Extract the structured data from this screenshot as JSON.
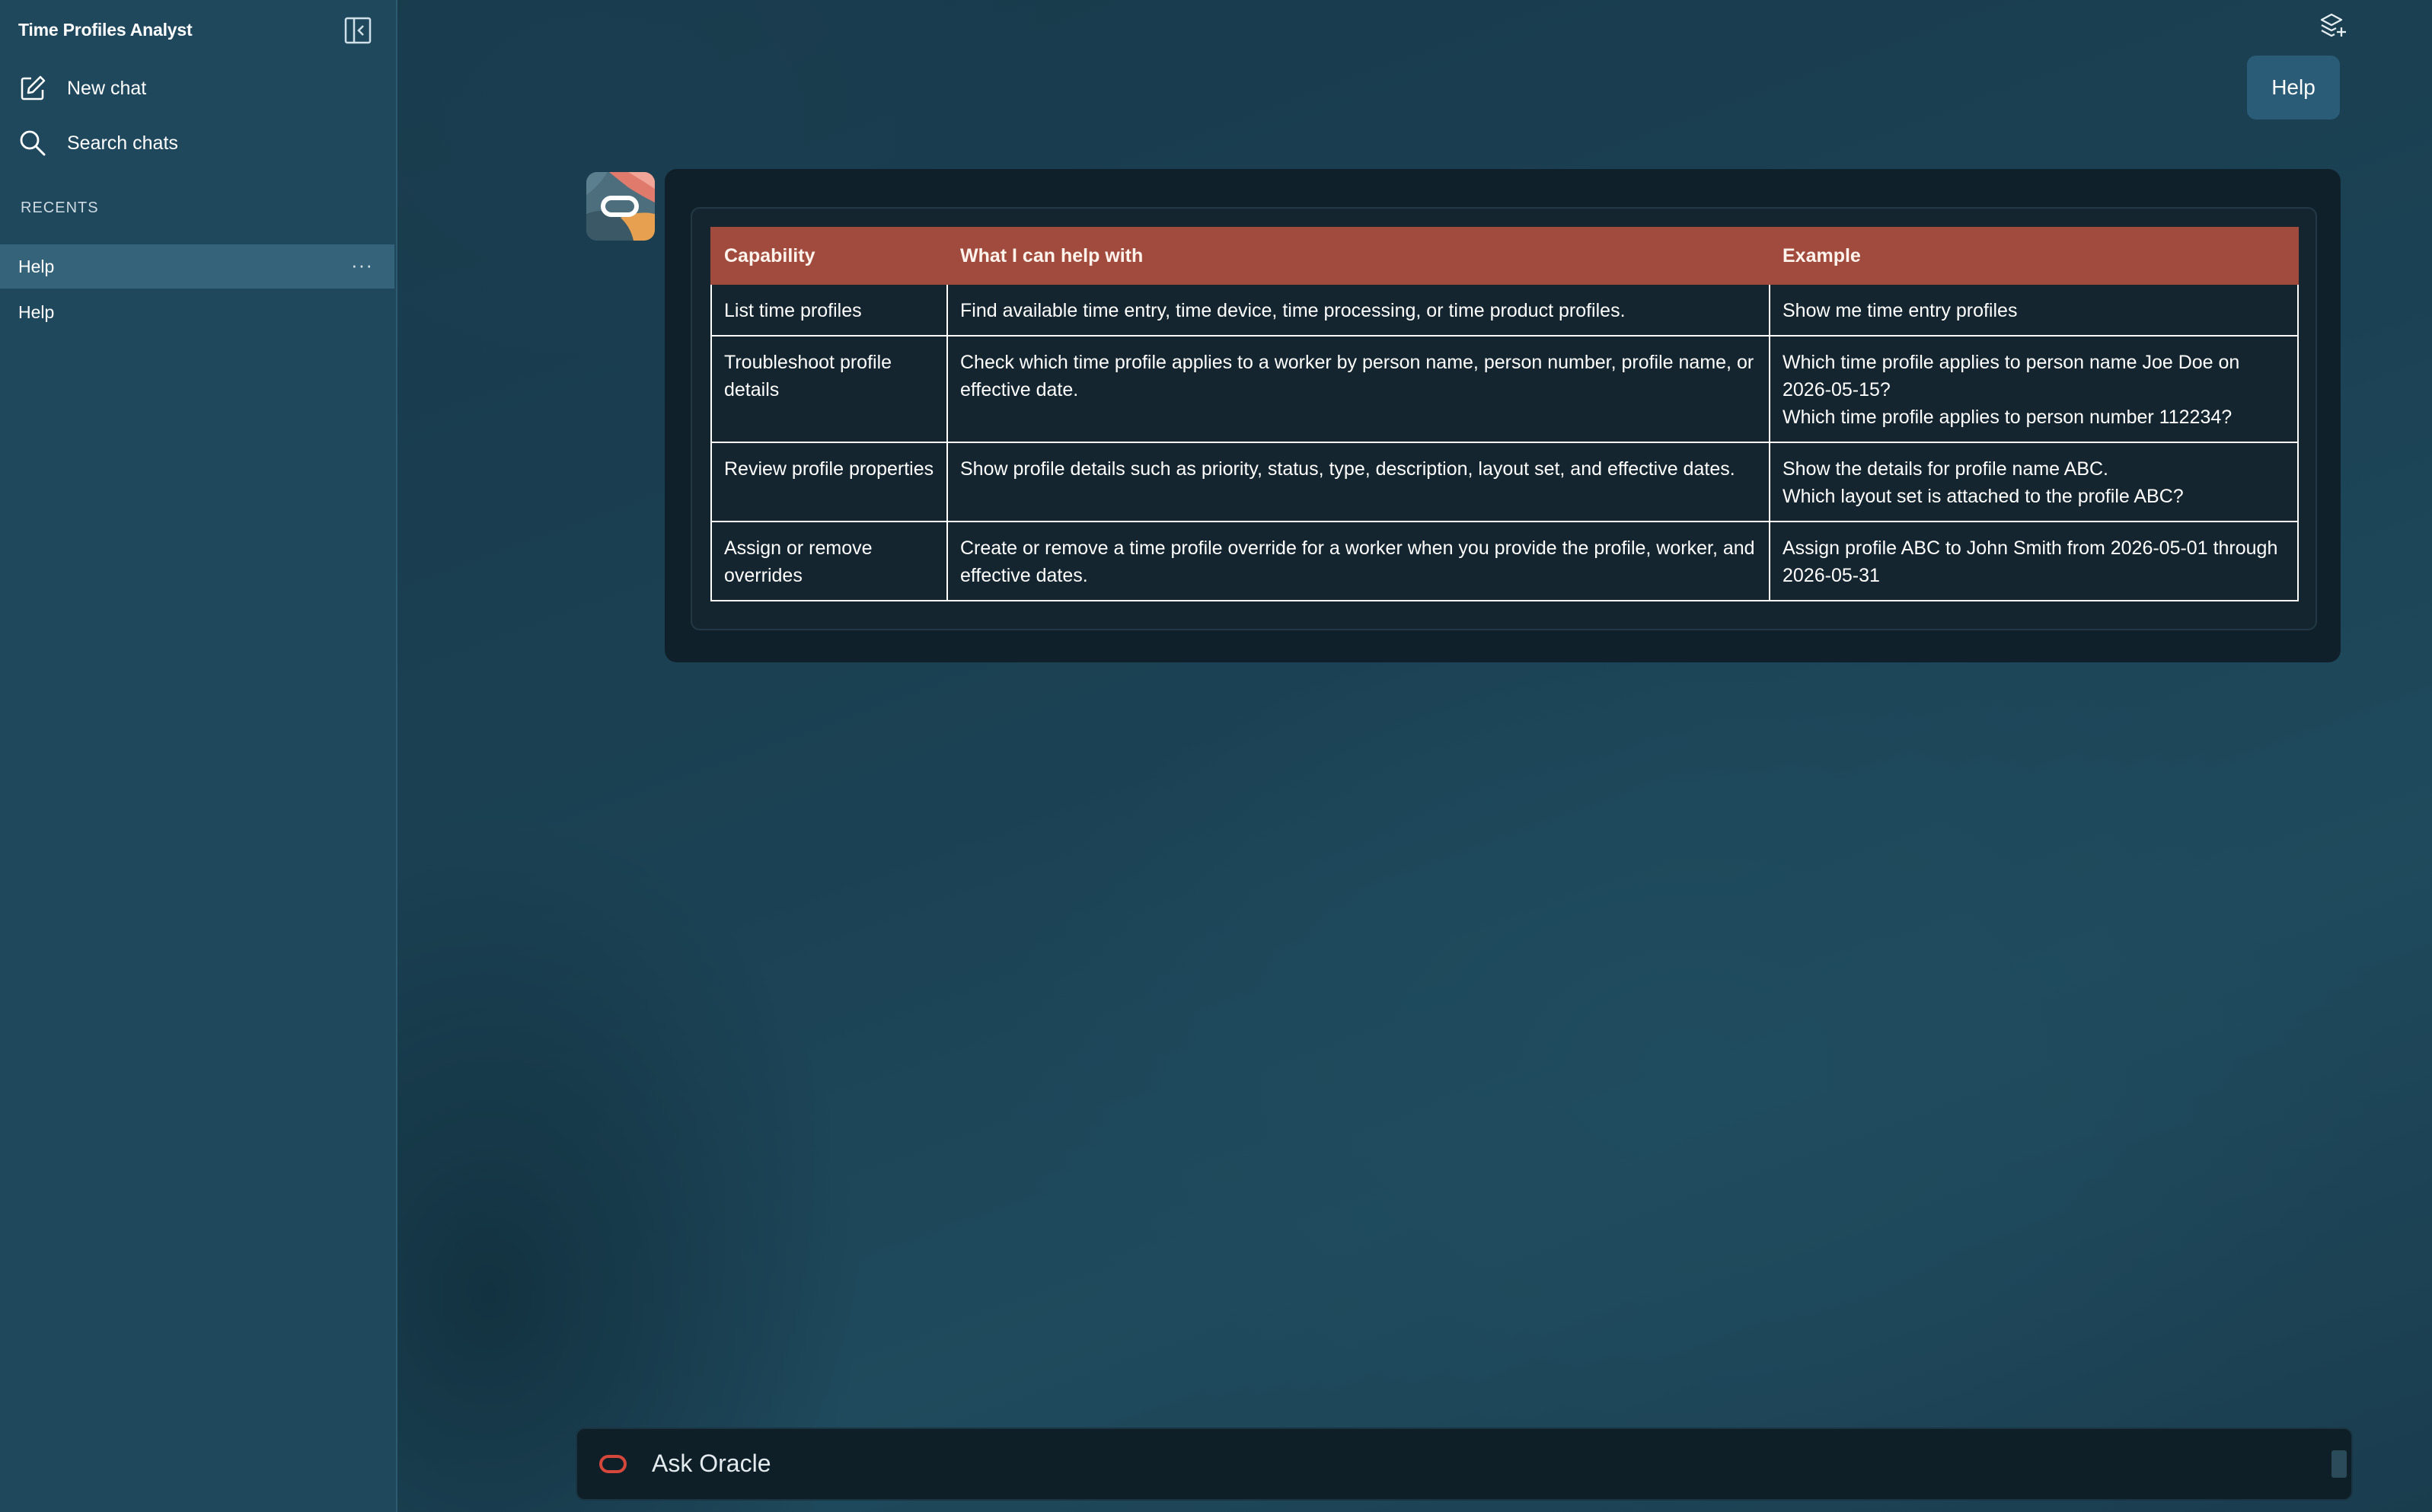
{
  "app": {
    "title": "Time Profiles Analyst"
  },
  "sidebar": {
    "actions": [
      {
        "label": "New chat",
        "icon": "compose-icon"
      },
      {
        "label": "Search chats",
        "icon": "search-icon"
      }
    ],
    "section_label": "RECENTS",
    "recents": [
      {
        "label": "Help",
        "active": true,
        "more": "···"
      },
      {
        "label": "Help",
        "active": false
      }
    ]
  },
  "header": {
    "icon": "layers-add-icon"
  },
  "conversation": {
    "user_message": "Help",
    "assistant": {
      "table": {
        "headers": [
          "Capability",
          "What I can help with",
          "Example"
        ],
        "rows": [
          {
            "capability": "List time profiles",
            "description": "Find available time entry, time device, time processing, or time product profiles.",
            "examples": [
              "Show me time entry profiles"
            ]
          },
          {
            "capability": "Troubleshoot profile details",
            "description": "Check which time profile applies to a worker by person name, person number, profile name, or effective date.",
            "examples": [
              "Which time profile applies to person name Joe Doe on 2026-05-15?",
              "Which time profile applies to person number 112234?"
            ]
          },
          {
            "capability": "Review profile properties",
            "description": "Show profile details such as priority, status, type, description, layout set, and effective dates.",
            "examples": [
              "Show the details for profile name ABC.",
              "Which layout set is attached to the profile ABC?"
            ]
          },
          {
            "capability": "Assign or remove overrides",
            "description": "Create or remove a time profile override for a worker when you provide the profile, worker, and effective dates.",
            "examples": [
              "Assign profile ABC to John Smith from 2026-05-01 through 2026-05-31"
            ]
          }
        ]
      }
    }
  },
  "input": {
    "placeholder": "Ask Oracle"
  },
  "colors": {
    "sidebar_bg": "#1f485d",
    "header_row": "#a14b3f",
    "card_bg": "#10202a",
    "oracle_red": "#d4473a"
  }
}
